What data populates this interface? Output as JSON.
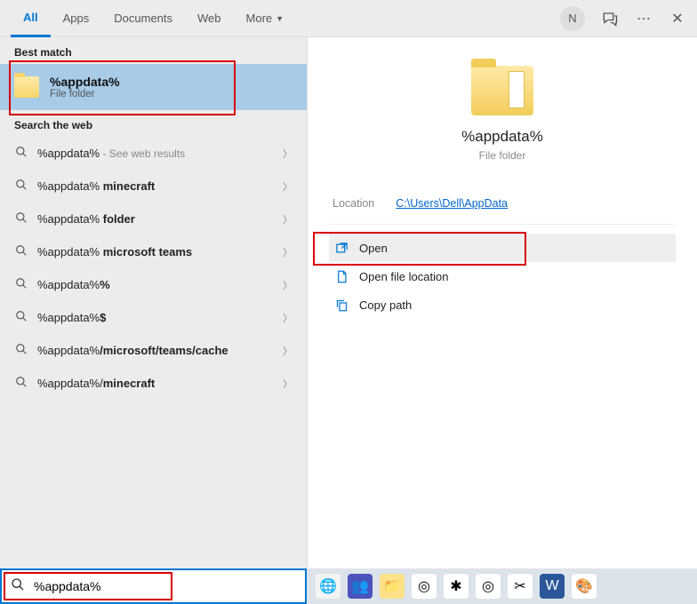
{
  "header": {
    "tabs": [
      "All",
      "Apps",
      "Documents",
      "Web",
      "More"
    ],
    "active_tab": 0,
    "avatar_initial": "N"
  },
  "left": {
    "best_match_label": "Best match",
    "best_match": {
      "title": "%appdata%",
      "subtitle": "File folder"
    },
    "web_label": "Search the web",
    "web_items": [
      {
        "prefix": "%appdata%",
        "bold": "",
        "hint": " - See web results"
      },
      {
        "prefix": "%appdata%",
        "bold": " minecraft",
        "hint": ""
      },
      {
        "prefix": "%appdata%",
        "bold": " folder",
        "hint": ""
      },
      {
        "prefix": "%appdata%",
        "bold": " microsoft teams",
        "hint": ""
      },
      {
        "prefix": "%appdata%",
        "bold": "%",
        "hint": ""
      },
      {
        "prefix": "%appdata%",
        "bold": "$",
        "hint": ""
      },
      {
        "prefix": "%appdata%",
        "bold": "/microsoft/teams/cache",
        "hint": ""
      },
      {
        "prefix": "%appdata%/",
        "bold": "minecraft",
        "hint": ""
      }
    ]
  },
  "right": {
    "title": "%appdata%",
    "subtitle": "File folder",
    "location_label": "Location",
    "location_value": "C:\\Users\\Dell\\AppData",
    "actions": [
      {
        "icon": "open-icon",
        "label": "Open",
        "highlight": true
      },
      {
        "icon": "file-location-icon",
        "label": "Open file location",
        "highlight": false
      },
      {
        "icon": "copy-path-icon",
        "label": "Copy path",
        "highlight": false
      }
    ]
  },
  "search": {
    "value": "%appdata%"
  },
  "taskbar_icons": [
    {
      "name": "edge-icon",
      "glyph": "🌐",
      "bg": "#f3f3f3"
    },
    {
      "name": "teams-icon",
      "glyph": "👥",
      "bg": "#4b53bc",
      "color": "#fff"
    },
    {
      "name": "explorer-icon",
      "glyph": "📁",
      "bg": "#ffe28a"
    },
    {
      "name": "chrome-icon",
      "glyph": "◎",
      "bg": "#fff"
    },
    {
      "name": "slack-icon",
      "glyph": "✱",
      "bg": "#fff"
    },
    {
      "name": "chrome2-icon",
      "glyph": "◎",
      "bg": "#fff"
    },
    {
      "name": "snip-icon",
      "glyph": "✂",
      "bg": "#fff"
    },
    {
      "name": "word-icon",
      "glyph": "W",
      "bg": "#2b579a",
      "color": "#fff"
    },
    {
      "name": "paint-icon",
      "glyph": "🎨",
      "bg": "#fff"
    }
  ]
}
